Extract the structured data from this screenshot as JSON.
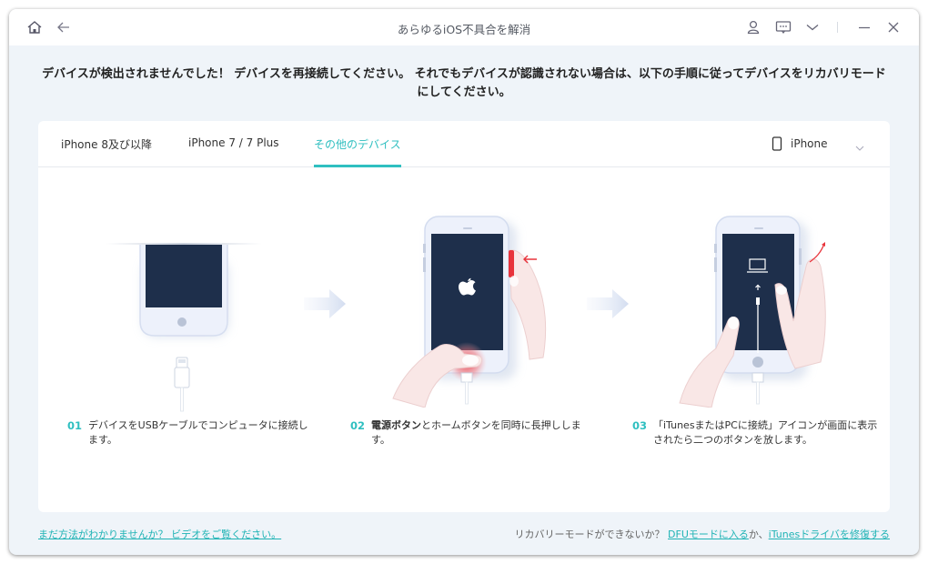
{
  "window": {
    "title": "あらゆるiOS不具合を解消",
    "icons": {
      "home": "home-icon",
      "back": "arrow-left-icon",
      "account": "user-icon",
      "feedback": "chat-bubble-icon",
      "menu": "chevron-down-icon",
      "minimize": "minimize-icon",
      "close": "close-icon"
    }
  },
  "headline": {
    "line1": "デバイスが検出されませんでした！ デバイスを再接続してください。 それでもデバイスが認識されない場合は、以下の手順に従ってデバイスをリカバリモード",
    "line2": "にしてください。"
  },
  "tabs": [
    {
      "label": "iPhone 8及び以降",
      "active": false
    },
    {
      "label": "iPhone 7 / 7 Plus",
      "active": false
    },
    {
      "label": "その他のデバイス",
      "active": true
    }
  ],
  "device_select": {
    "icon": "phone-icon",
    "value": "iPhone"
  },
  "steps": [
    {
      "num": "01",
      "text": "デバイスをUSBケーブルでコンピュータに接続します。",
      "illustration": "phone-with-lightning-cable"
    },
    {
      "num": "02",
      "bold": "電源ボタン",
      "text": "とホームボタンを同時に長押しします。",
      "illustration": "hands-pressing-power-and-home-buttons"
    },
    {
      "num": "03",
      "text": "「iTunesまたはPCに接続」アイコンが画面に表示されたら二つのボタンを放します。",
      "illustration": "hands-releasing-buttons-connect-to-itunes-screen"
    }
  ],
  "footer": {
    "help_link": "まだ方法がわかりませんか？ ビデオをご覧ください。",
    "recovery_question": "リカバリーモードができないか？ ",
    "dfu_link": "DFUモードに入る",
    "separator": "か、",
    "itunes_link": "iTunesドライバを修復する"
  },
  "colors": {
    "accent": "#2fbfc0",
    "background": "#eff4f9",
    "screen": "#1e2f4b",
    "highlight_red": "#e8343c"
  }
}
